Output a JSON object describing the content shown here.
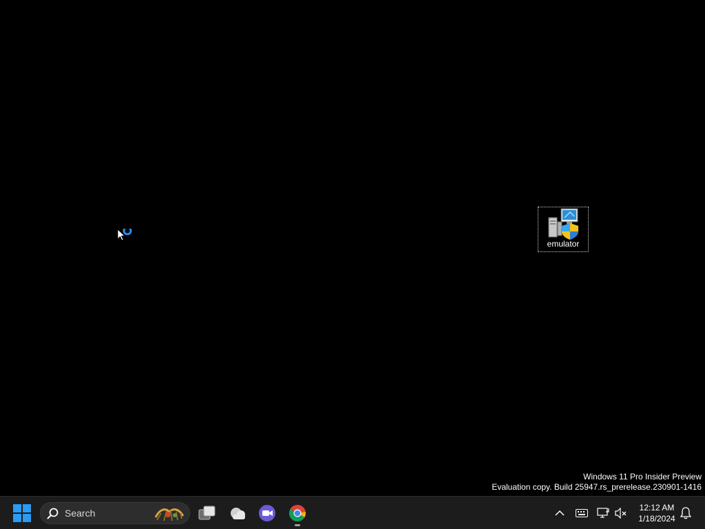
{
  "desktop": {
    "icons": [
      {
        "label": "emulator",
        "icon": "installer-shield-icon"
      }
    ],
    "watermark": {
      "line1": "Windows 11 Pro Insider Preview",
      "line2": "Evaluation copy. Build 25947.rs_prerelease.230901-1416"
    },
    "cursor": "busy-pointer"
  },
  "taskbar": {
    "start_icon": "windows-logo-icon",
    "search": {
      "placeholder": "Search"
    },
    "pinned": [
      {
        "name": "task-view",
        "icon": "task-view-icon"
      },
      {
        "name": "weather",
        "icon": "weather-cloud-icon"
      },
      {
        "name": "video-meeting",
        "icon": "video-camera-icon"
      },
      {
        "name": "chrome",
        "icon": "chrome-icon",
        "running": true
      }
    ],
    "tray": {
      "icons": [
        "chevron-up-icon",
        "keyboard-icon",
        "network-icon",
        "volume-muted-icon"
      ],
      "time": "12:12 AM",
      "date": "1/18/2024",
      "notification_icon": "bell-icon"
    }
  },
  "colors": {
    "desktop_bg": "#000000",
    "taskbar_bg": "#1c1c1c",
    "windows_blue": "#2b9bf4"
  }
}
